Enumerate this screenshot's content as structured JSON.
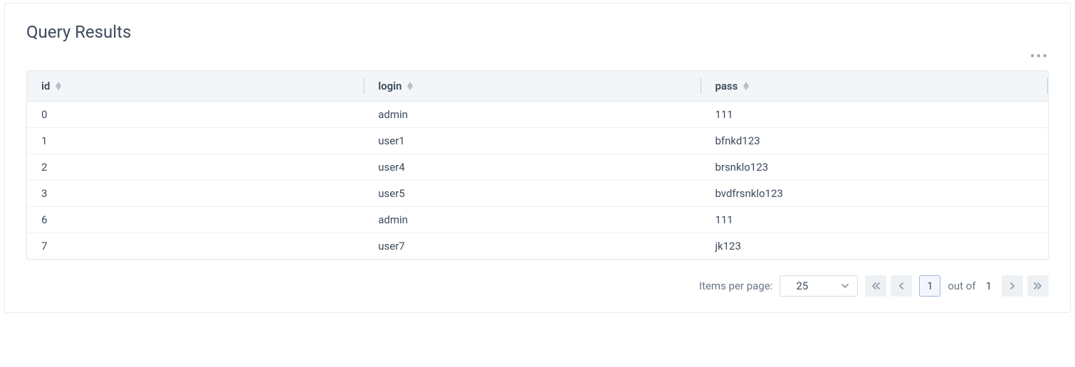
{
  "panel": {
    "title": "Query Results"
  },
  "table": {
    "columns": [
      "id",
      "login",
      "pass"
    ],
    "rows": [
      {
        "id": "0",
        "login": "admin",
        "pass": "111"
      },
      {
        "id": "1",
        "login": "user1",
        "pass": "bfnkd123"
      },
      {
        "id": "2",
        "login": "user4",
        "pass": "brsnklo123"
      },
      {
        "id": "3",
        "login": "user5",
        "pass": "bvdfrsnklo123"
      },
      {
        "id": "6",
        "login": "admin",
        "pass": "111"
      },
      {
        "id": "7",
        "login": "user7",
        "pass": "jk123"
      }
    ]
  },
  "pagination": {
    "items_per_page_label": "Items per page:",
    "items_per_page_value": "25",
    "current_page": "1",
    "out_of_label": "out of",
    "total_pages": "1"
  }
}
